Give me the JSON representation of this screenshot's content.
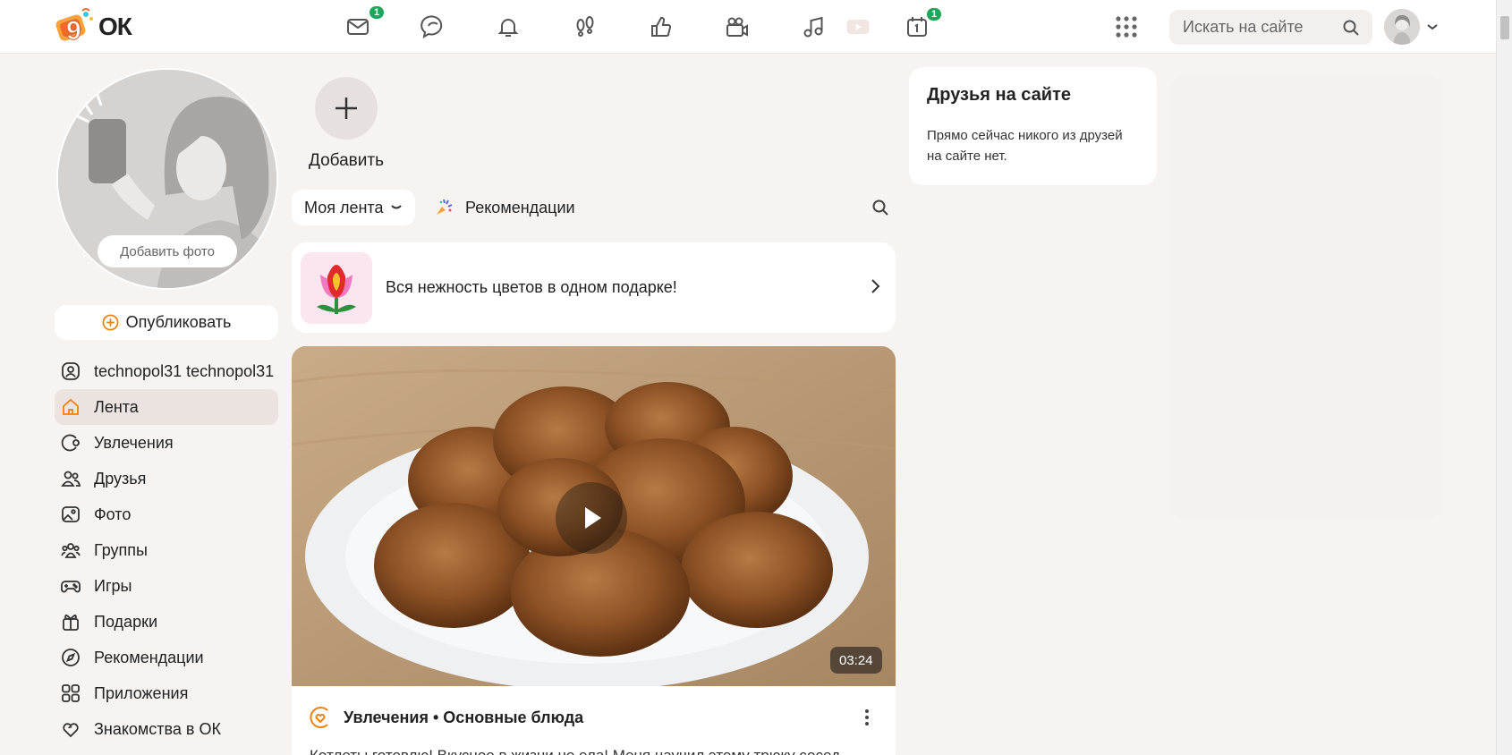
{
  "header": {
    "logo_text": "ОК",
    "nav": [
      {
        "name": "messages",
        "icon": "envelope-icon",
        "badge": "1"
      },
      {
        "name": "discussions",
        "icon": "chat-bubbles-icon",
        "badge": ""
      },
      {
        "name": "notifications",
        "icon": "bell-icon",
        "badge": ""
      },
      {
        "name": "guests",
        "icon": "footprints-icon",
        "badge": ""
      },
      {
        "name": "events",
        "icon": "thumbs-up-icon",
        "badge": ""
      },
      {
        "name": "video",
        "icon": "video-camera-icon",
        "badge": ""
      },
      {
        "name": "music",
        "icon": "music-note-icon",
        "badge": ""
      },
      {
        "name": "calendar",
        "icon": "calendar-icon",
        "badge": "1"
      }
    ],
    "search_placeholder": "Искать на сайте"
  },
  "profile": {
    "add_photo_label": "Добавить фото",
    "publish_label": "Опубликовать"
  },
  "sidebar": {
    "items": [
      {
        "label": "technopol31 technopol31",
        "icon": "user-icon",
        "active": false
      },
      {
        "label": "Лента",
        "icon": "home-icon",
        "active": true
      },
      {
        "label": "Увлечения",
        "icon": "hobby-icon",
        "active": false
      },
      {
        "label": "Друзья",
        "icon": "friends-icon",
        "active": false
      },
      {
        "label": "Фото",
        "icon": "photo-icon",
        "active": false
      },
      {
        "label": "Группы",
        "icon": "groups-icon",
        "active": false
      },
      {
        "label": "Игры",
        "icon": "gamepad-icon",
        "active": false
      },
      {
        "label": "Подарки",
        "icon": "gift-icon",
        "active": false
      },
      {
        "label": "Рекомендации",
        "icon": "compass-icon",
        "active": false
      },
      {
        "label": "Приложения",
        "icon": "apps-grid-icon",
        "active": false
      },
      {
        "label": "Знакомства в ОК",
        "icon": "hearts-icon",
        "active": false
      }
    ]
  },
  "feed": {
    "add_story_label": "Добавить",
    "tab_mine": "Моя лента",
    "tab_recommendations": "Рекомендации",
    "promo_text": "Вся нежность цветов в одном подарке!",
    "post": {
      "duration": "03:24",
      "source": "Увлечения • Основные блюда",
      "text": "Котлеты готовлю! Вкусное в жизни не ела! Меня научил этому трюку сосед"
    }
  },
  "friends_online": {
    "title": "Друзья на сайте",
    "text": "Прямо сейчас никого из друзей на сайте нет."
  },
  "colors": {
    "accent": "#ee8208",
    "badge": "#1ca85b",
    "background": "#f6f3f1"
  }
}
